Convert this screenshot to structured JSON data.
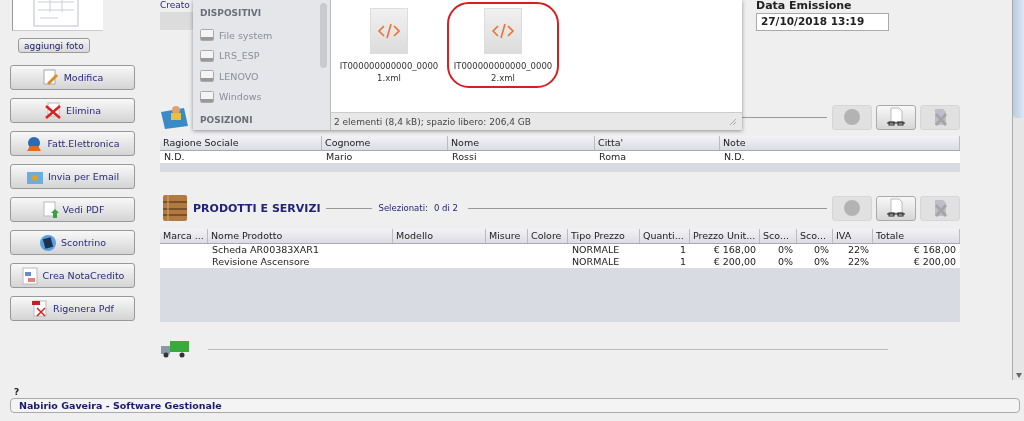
{
  "left_panel": {
    "add_photo_button": "aggiungi foto",
    "actions": [
      {
        "label": "Modifica",
        "kind": "edit"
      },
      {
        "label": "Elimina",
        "kind": "delete"
      },
      {
        "label": "Fatt.Elettronica",
        "kind": "einvoice"
      },
      {
        "label": "Invia per Email",
        "kind": "email"
      },
      {
        "label": "Vedi PDF",
        "kind": "pdf"
      },
      {
        "label": "Scontrino",
        "kind": "receipt"
      },
      {
        "label": "Crea NotaCredito",
        "kind": "credit"
      },
      {
        "label": "Rigenera Pdf",
        "kind": "regen"
      }
    ]
  },
  "header": {
    "created_label": "Creato",
    "date_label": "Data Emissione",
    "date_value": "27/10/2018 13:19"
  },
  "client_section": {
    "tools": [
      {
        "kind": "add",
        "disabled": true
      },
      {
        "kind": "view",
        "disabled": false
      },
      {
        "kind": "remove",
        "disabled": true
      }
    ],
    "table": {
      "columns": [
        "Ragione Sociale",
        "Cognome",
        "Nome",
        "Citta'",
        "Note"
      ],
      "rows": [
        [
          "N.D.",
          "Mario",
          "Rossi",
          "Roma",
          "N.D."
        ]
      ]
    }
  },
  "products_section": {
    "title": "PRODOTTI E SERVIZI",
    "selected_label": "Selezionati:",
    "selected_count": "0 di 2",
    "tools": [
      {
        "kind": "add",
        "disabled": true
      },
      {
        "kind": "view",
        "disabled": false
      },
      {
        "kind": "remove",
        "disabled": true
      }
    ],
    "table": {
      "columns": [
        "Marca ...",
        "Nome Prodotto",
        "Modello",
        "Misure",
        "Colore",
        "Tipo Prezzo",
        "Quanti...",
        "Prezzo Unit...",
        "Sco...",
        "Sco...",
        "IVA",
        "Totale"
      ],
      "rows": [
        [
          "",
          "Scheda AR00383XAR1",
          "",
          "",
          "",
          "NORMALE",
          "1",
          "€ 168,00",
          "0%",
          "0%",
          "22%",
          "€ 168,00"
        ],
        [
          "",
          "Revisione Ascensore",
          "",
          "",
          "",
          "NORMALE",
          "1",
          "€ 200,00",
          "0%",
          "0%",
          "22%",
          "€ 200,00"
        ]
      ]
    }
  },
  "help_mark": "?",
  "status_bar": "Nabirio Gaveira - Software Gestionale",
  "file_dialog": {
    "sidebar": [
      {
        "heading": "DISPOSITIVI",
        "items": [
          "File system",
          "LRS_ESP",
          "LENOVO",
          "Windows"
        ]
      },
      {
        "heading": "POSIZIONI"
      }
    ],
    "files": [
      {
        "line1": "IT000000000000_0000",
        "line2": "1.xml",
        "highlighted": false
      },
      {
        "line1": "IT000000000000_0000",
        "line2": "2.xml",
        "highlighted": true
      }
    ],
    "status": "2 elementi (8,4 kB); spazio libero: 206,4 GB"
  }
}
